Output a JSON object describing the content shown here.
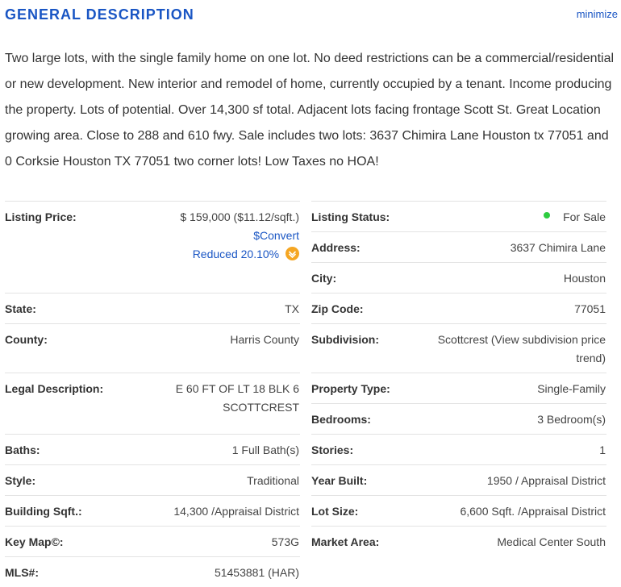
{
  "header": {
    "title": "GENERAL DESCRIPTION",
    "minimize_label": "minimize"
  },
  "description": "Two large lots, with the single family home on one lot. No deed restrictions can be a commercial/residential or new development. New interior and remodel of home, currently occupied by a tenant. Income producing the property. Lots of potential. Over 14,300 sf total. Adjacent lots facing frontage Scott St. Great Location growing area. Close to 288 and 610 fwy. Sale includes two lots: 3637 Chimira Lane Houston tx 77051 and 0 Corksie Houston TX 77051 two corner lots! Low Taxes no HOA!",
  "left": {
    "listing_price_label": "Listing Price:",
    "listing_price_value": "$ 159,000 ($11.12/sqft.)",
    "convert_link": "$Convert",
    "reduced_text": "Reduced 20.10%",
    "state_label": "State:",
    "state_value": "TX",
    "county_label": "County:",
    "county_value": "Harris County",
    "legal_label": "Legal Description:",
    "legal_line1": "E 60 FT OF LT 18 BLK 6",
    "legal_line2": "SCOTTCREST",
    "baths_label": "Baths:",
    "baths_value": "1 Full Bath(s)",
    "style_label": "Style:",
    "style_value": "Traditional",
    "sqft_label": "Building Sqft.:",
    "sqft_value": "14,300 /Appraisal District",
    "keymap_label": "Key Map©:",
    "keymap_value": "573G",
    "mls_label": "MLS#:",
    "mls_value": "51453881 (HAR)"
  },
  "right": {
    "status_label": "Listing Status:",
    "status_value": "For Sale",
    "address_label": "Address:",
    "address_value": "3637 Chimira Lane",
    "city_label": "City:",
    "city_value": "Houston",
    "zip_label": "Zip Code:",
    "zip_value": "77051",
    "subdivision_label": "Subdivision:",
    "subdivision_value": "Scottcrest (View subdivision price trend)",
    "type_label": "Property Type:",
    "type_value": "Single-Family",
    "bedrooms_label": "Bedrooms:",
    "bedrooms_value": "3 Bedroom(s)",
    "stories_label": "Stories:",
    "stories_value": "1",
    "year_label": "Year Built:",
    "year_value": "1950 / Appraisal District",
    "lot_label": "Lot Size:",
    "lot_value": "6,600 Sqft. /Appraisal District",
    "market_label": "Market Area:",
    "market_value": "Medical Center South"
  },
  "colors": {
    "accent": "#1a56c4",
    "status_dot": "#2ecc40",
    "reduced_icon": "#f5a623"
  },
  "icons": {
    "status": "status-dot-icon",
    "reduced": "arrow-down-circle-icon"
  }
}
